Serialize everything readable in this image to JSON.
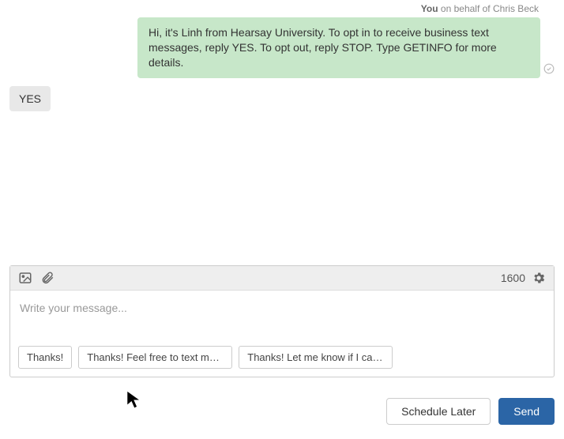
{
  "sender": {
    "you": "You",
    "on_behalf": "on behalf of Chris Beck"
  },
  "messages": {
    "outgoing": "Hi, it's Linh from Hearsay University. To opt in to receive business text messages, reply YES. To opt out, reply STOP. Type GETINFO for more details.",
    "incoming": "YES"
  },
  "composer": {
    "char_count": "1600",
    "placeholder": "Write your message..."
  },
  "suggestions": [
    "Thanks!",
    "Thanks! Feel free to text me anytime.",
    "Thanks! Let me know if I can help."
  ],
  "buttons": {
    "schedule": "Schedule Later",
    "send": "Send"
  }
}
